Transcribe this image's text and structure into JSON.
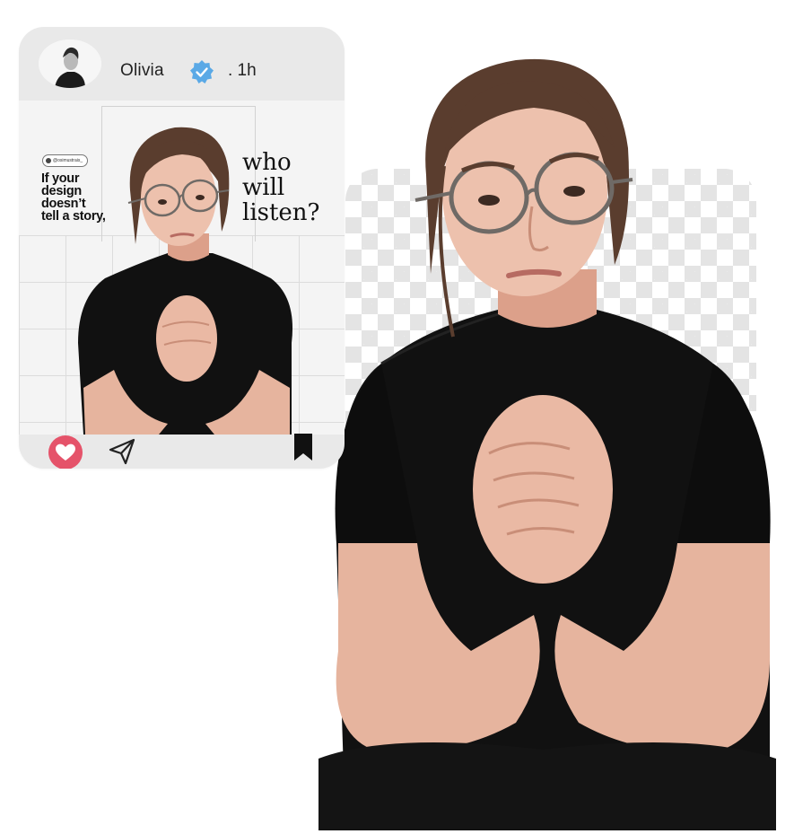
{
  "post": {
    "username": "Olivia",
    "time": ". 1h",
    "handle": "@osimustrais_",
    "tagline": [
      "If your",
      "design",
      "doesn’t",
      "tell a story,"
    ],
    "headline": [
      "who",
      "will",
      "listen?"
    ]
  },
  "icons": {
    "avatar": "avatar-photo",
    "verified": "verified-badge-icon",
    "like": "heart-icon",
    "share": "send-icon",
    "save": "bookmark-icon"
  },
  "colors": {
    "card_bg": "#e9e9e9",
    "verified_blue": "#5aa9e6",
    "like_red": "#e5536a",
    "shirt": "#111111",
    "skin": "#e9b7a2",
    "hair": "#5a3d2e"
  }
}
